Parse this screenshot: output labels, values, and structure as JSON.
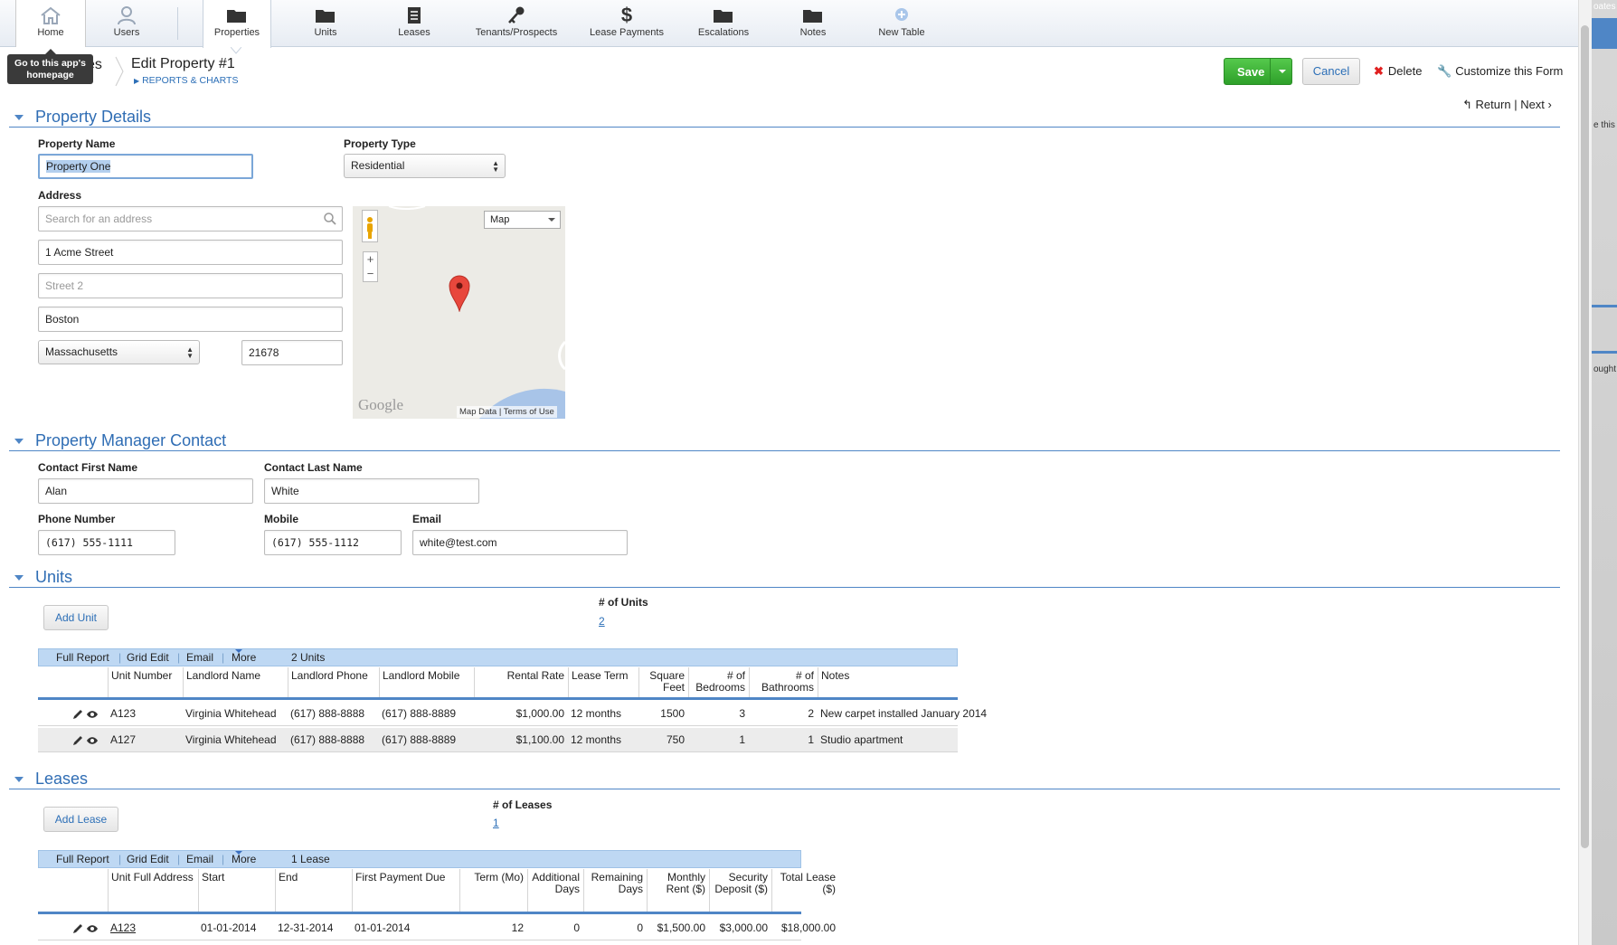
{
  "nav": {
    "home": "Home",
    "users": "Users",
    "properties": "Properties",
    "units": "Units",
    "leases": "Leases",
    "tenants": "Tenants/Prospects",
    "lease_payments": "Lease Payments",
    "escalations": "Escalations",
    "notes": "Notes",
    "new_table": "New Table"
  },
  "tooltip": "Go to this app's homepage",
  "breadcrumb": {
    "parent": "es",
    "parent_sub": "S",
    "title": "Edit Property #1",
    "reports": "REPORTS & CHARTS"
  },
  "actions": {
    "save": "Save",
    "cancel": "Cancel",
    "delete": "Delete",
    "customize": "Customize this Form",
    "return": "Return",
    "next": "Next"
  },
  "property_details": {
    "heading": "Property Details",
    "name_label": "Property Name",
    "name_value": "Property One",
    "type_label": "Property Type",
    "type_value": "Residential",
    "address_label": "Address",
    "search_placeholder": "Search for an address",
    "street1": "1 Acme Street",
    "street2_placeholder": "Street 2",
    "city": "Boston",
    "state": "Massachusetts",
    "zip": "21678",
    "map": {
      "type": "Map",
      "logo": "Google",
      "map_data": "Map Data",
      "terms": "Terms of Use"
    }
  },
  "manager": {
    "heading": "Property Manager Contact",
    "first_label": "Contact First Name",
    "first_value": "Alan",
    "last_label": "Contact Last Name",
    "last_value": "White",
    "phone_label": "Phone Number",
    "phone_value": "(617) 555-1111",
    "mobile_label": "Mobile",
    "mobile_value": "(617) 555-1112",
    "email_label": "Email",
    "email_value": "white@test.com"
  },
  "units": {
    "heading": "Units",
    "add_label": "Add  Unit",
    "count_label": "# of Units",
    "count_value": "2",
    "toolbar": {
      "full": "Full Report",
      "grid": "Grid Edit",
      "email": "Email",
      "more": "More",
      "summary": "2 Units"
    },
    "columns": [
      "Unit Number",
      "Landlord Name",
      "Landlord Phone",
      "Landlord Mobile",
      "Rental Rate",
      "Lease Term",
      "Square Feet",
      "# of Bedrooms",
      "# of Bathrooms",
      "Notes"
    ],
    "rows": [
      [
        "A123",
        "Virginia Whitehead",
        "(617) 888-8888",
        "(617) 888-8889",
        "$1,000.00",
        "12 months",
        "1500",
        "3",
        "2",
        "New carpet installed January 2014"
      ],
      [
        "A127",
        "Virginia Whitehead",
        "(617) 888-8888",
        "(617) 888-8889",
        "$1,100.00",
        "12 months",
        "750",
        "1",
        "1",
        "Studio apartment"
      ]
    ]
  },
  "leases": {
    "heading": "Leases",
    "add_label": "Add  Lease",
    "count_label": "# of Leases",
    "count_value": "1",
    "toolbar": {
      "full": "Full Report",
      "grid": "Grid Edit",
      "email": "Email",
      "more": "More",
      "summary": "1 Lease"
    },
    "columns": [
      "Unit Full Address",
      "Start",
      "End",
      "First Payment Due",
      "Term (Mo)",
      "Additional Days",
      "Remaining Days",
      "Monthly Rent ($)",
      "Security Deposit ($)",
      "Total Lease ($)"
    ],
    "rows": [
      [
        "A123",
        "01-01-2014",
        "12-31-2014",
        "01-01-2014",
        "12",
        "0",
        "0",
        "$1,500.00",
        "$3,000.00",
        "$18,000.00"
      ]
    ]
  },
  "edge_text": {
    "top": "oates",
    "mid1": "e this",
    "mid2": "ought"
  },
  "colors": {
    "accent": "#2f6db4",
    "save": "#2ea02a",
    "grid_toolbar": "#bed8f3"
  }
}
